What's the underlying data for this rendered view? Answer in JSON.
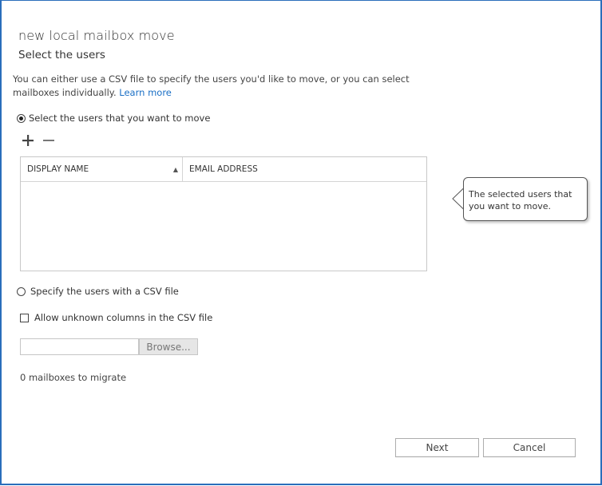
{
  "dialog": {
    "title": "new local mailbox move",
    "subtitle": "Select the users",
    "description": "You can either use a CSV file to specify the users you'd like to move, or you can select mailboxes individually.",
    "learn_more": "Learn more"
  },
  "options": {
    "select_users_label": "Select the users that you want to move",
    "select_users_selected": true,
    "csv_label": "Specify the users with a CSV file",
    "csv_selected": false
  },
  "toolbar": {
    "add_icon": "plus-icon",
    "remove_icon": "minus-icon"
  },
  "grid": {
    "columns": [
      "DISPLAY NAME",
      "EMAIL ADDRESS"
    ],
    "sorted_column": "DISPLAY NAME",
    "sort_direction": "ascending",
    "rows": []
  },
  "tooltip": {
    "text": "The selected users that you want to move."
  },
  "csv": {
    "allow_unknown_label": "Allow unknown columns in the CSV file",
    "allow_unknown_checked": false,
    "file_value": "",
    "browse_label": "Browse..."
  },
  "status": {
    "mailbox_count_text": "0 mailboxes to migrate"
  },
  "footer": {
    "next_label": "Next",
    "cancel_label": "Cancel"
  },
  "colors": {
    "frame_border": "#2a6ebb",
    "link": "#1a6fc5"
  }
}
